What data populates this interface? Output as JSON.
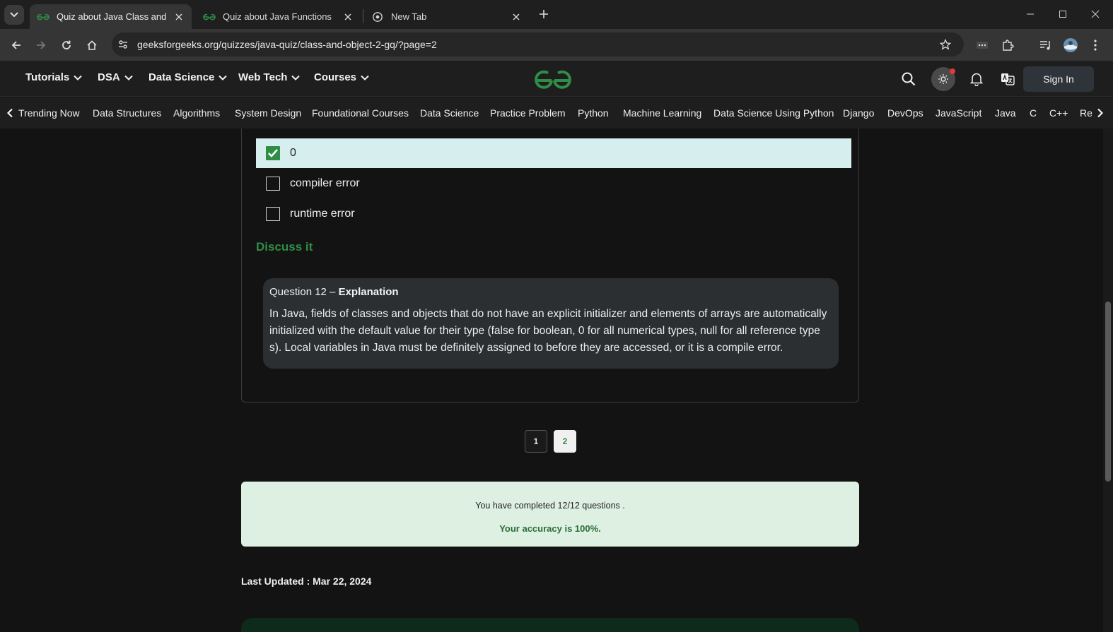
{
  "browser": {
    "tabs": [
      {
        "title": "Quiz about Java Class and Obje",
        "active": true
      },
      {
        "title": "Quiz about Java Functions",
        "active": false
      },
      {
        "title": "New Tab",
        "active": false
      }
    ],
    "url": "geeksforgeeks.org/quizzes/java-quiz/class-and-object-2-gq/?page=2"
  },
  "site": {
    "nav": [
      "Tutorials",
      "DSA",
      "Data Science",
      "Web Tech",
      "Courses"
    ],
    "sign_in": "Sign In",
    "subnav": [
      "Trending Now",
      "Data Structures",
      "Algorithms",
      "System Design",
      "Foundational Courses",
      "Data Science",
      "Practice Problem",
      "Python",
      "Machine Learning",
      "Data Science Using Python",
      "Django",
      "DevOps",
      "JavaScript",
      "Java",
      "C",
      "C++",
      "Re"
    ]
  },
  "question": {
    "options": [
      {
        "label": "0",
        "checked": true
      },
      {
        "label": "compiler error",
        "checked": false
      },
      {
        "label": "runtime error",
        "checked": false
      }
    ],
    "discuss": "Discuss it",
    "explanation_prefix": "Question 12 – ",
    "explanation_title": "Explanation",
    "explanation_text": "In Java, fields of classes and objects that do not have an explicit initializer and elements of arrays are automatically initialized with the default value for their type (false for boolean, 0 for all numerical types, null for all reference types). Local variables in Java must be definitely assigned to before they are accessed, or it is a compile error."
  },
  "pagination": {
    "pages": [
      "1",
      "2"
    ],
    "current": "2"
  },
  "result": {
    "completed": "You have completed 12/12 questions .",
    "accuracy": "Your accuracy is 100%."
  },
  "last_updated": "Last Updated : Mar 22, 2024",
  "colors": {
    "brand_green": "#2f8d46",
    "selected_option": "#d6efee",
    "result_bg": "#def0e2"
  }
}
